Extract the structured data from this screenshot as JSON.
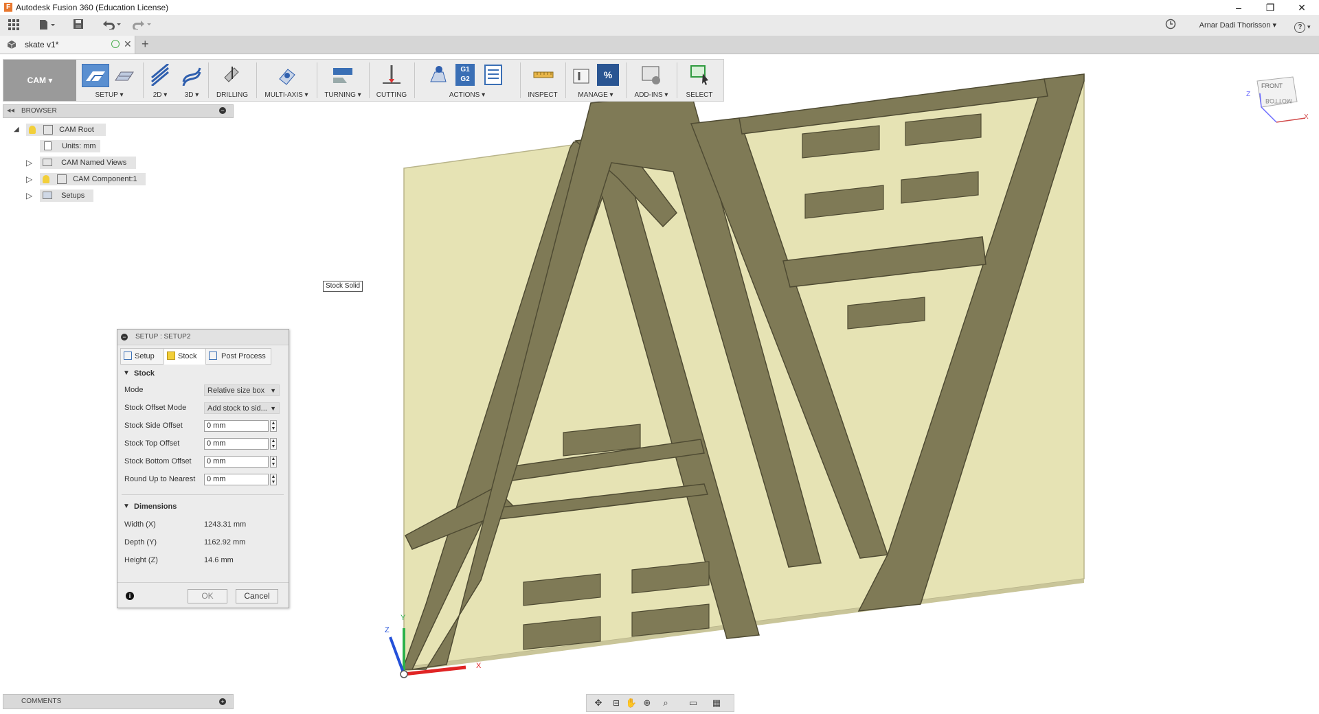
{
  "window": {
    "title": "Autodesk Fusion 360 (Education License)",
    "app_icon_letter": "F",
    "minimize": "–",
    "restore": "❐",
    "close": "✕"
  },
  "qat": {
    "grid_icon": "grid-icon",
    "user_name": "Arnar Dadi Thorisson",
    "help_label": "?"
  },
  "doc_tab": {
    "name": "skate v1*",
    "new_tab": "+"
  },
  "ribbon": {
    "workspace": "CAM",
    "groups": [
      {
        "label": "SETUP ▾"
      },
      {
        "label": "2D ▾"
      },
      {
        "label": "3D ▾"
      },
      {
        "label": "DRILLING"
      },
      {
        "label": "MULTI-AXIS ▾"
      },
      {
        "label": "TURNING ▾"
      },
      {
        "label": "CUTTING"
      },
      {
        "label": "ACTIONS ▾"
      },
      {
        "label": "INSPECT"
      },
      {
        "label": "MANAGE ▾"
      },
      {
        "label": "ADD-INS ▾"
      },
      {
        "label": "SELECT"
      }
    ],
    "g1g2_top": "G1",
    "g1g2_bottom": "G2",
    "percent": "%"
  },
  "browser": {
    "title": "BROWSER",
    "items": [
      {
        "label": "CAM Root"
      },
      {
        "label": "Units: mm"
      },
      {
        "label": "CAM Named Views"
      },
      {
        "label": "CAM Component:1"
      },
      {
        "label": "Setups"
      }
    ]
  },
  "tooltip": "Stock Solid",
  "dialog": {
    "title": "SETUP : SETUP2",
    "tabs": [
      {
        "label": "Setup"
      },
      {
        "label": "Stock"
      },
      {
        "label": "Post Process"
      }
    ],
    "stock_section": "Stock",
    "rows": [
      {
        "label": "Mode",
        "value": "Relative size box"
      },
      {
        "label": "Stock Offset Mode",
        "value": "Add stock to sid..."
      },
      {
        "label": "Stock Side Offset",
        "value": "0 mm"
      },
      {
        "label": "Stock Top Offset",
        "value": "0 mm"
      },
      {
        "label": "Stock Bottom Offset",
        "value": "0 mm"
      },
      {
        "label": "Round Up to Nearest",
        "value": "0 mm"
      }
    ],
    "dimensions_section": "Dimensions",
    "dims": [
      {
        "label": "Width (X)",
        "value": "1243.31 mm"
      },
      {
        "label": "Depth (Y)",
        "value": "1162.92 mm"
      },
      {
        "label": "Height (Z)",
        "value": "14.6 mm"
      }
    ],
    "ok": "OK",
    "cancel": "Cancel",
    "info": "i"
  },
  "comments": {
    "title": "COMMENTS"
  },
  "viewcube": {
    "front": "FRONT",
    "bottom": "BOTTOM",
    "axis_z": "Z",
    "axis_x": "X"
  },
  "triad": {
    "z": "Z",
    "y": "Y",
    "x": "X"
  },
  "colors": {
    "stock": "#e6e3b4",
    "part": "#7f7a56",
    "part_dark": "#4f4b33",
    "ribbon_bg": "#ececec",
    "accent": "#3a7bd5"
  }
}
